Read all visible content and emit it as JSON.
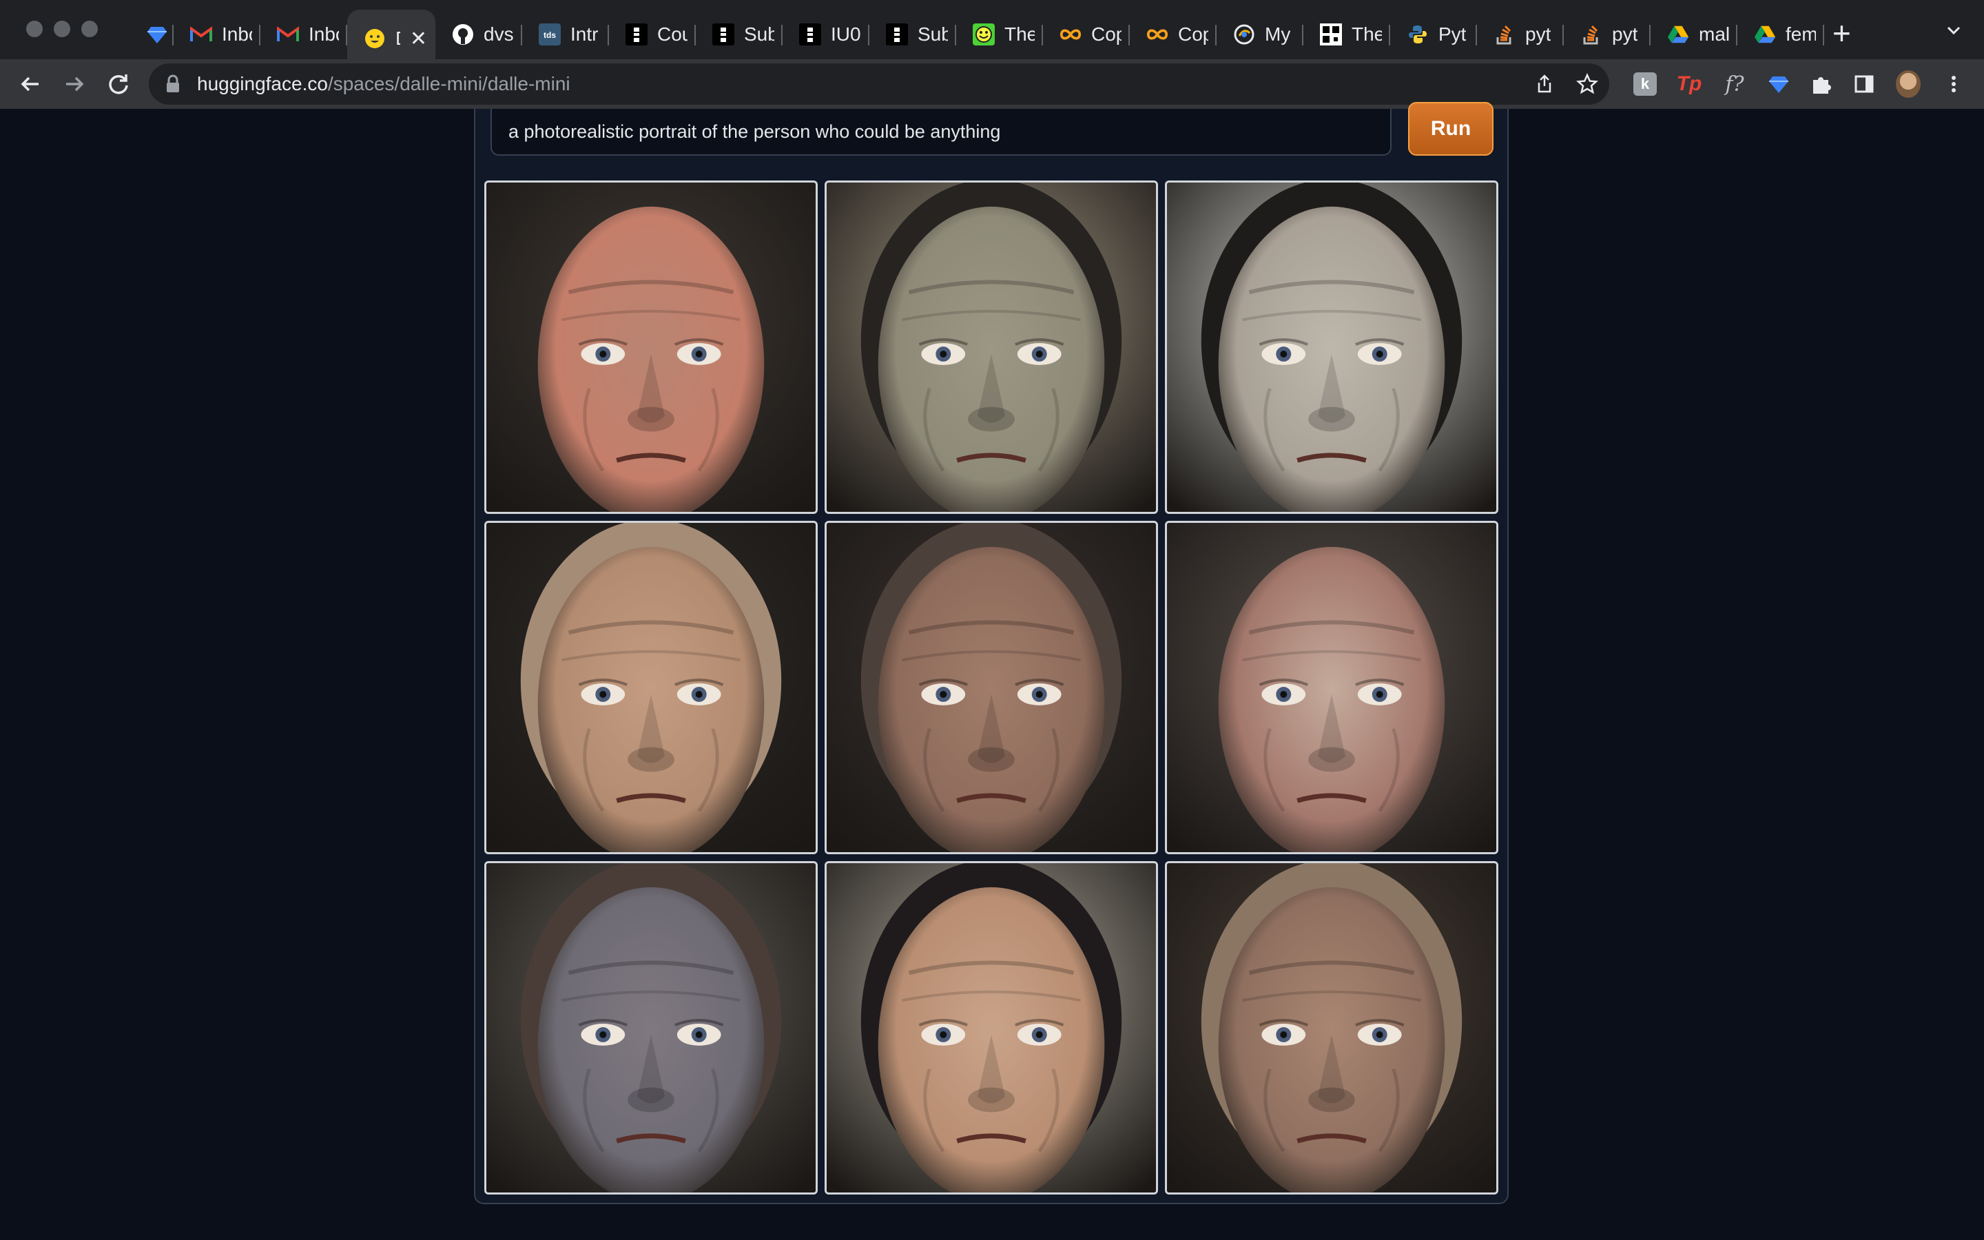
{
  "browser": {
    "tabs": [
      {
        "title": "",
        "icon": "gem-icon"
      },
      {
        "title": "Inbo",
        "icon": "gmail-icon"
      },
      {
        "title": "Inbo",
        "icon": "gmail-icon"
      },
      {
        "title": "D",
        "icon": "huggingface-icon",
        "active": true
      },
      {
        "title": "dvs",
        "icon": "github-icon"
      },
      {
        "title": "Intr",
        "icon": "tds-icon"
      },
      {
        "title": "Cou",
        "icon": "dots-icon"
      },
      {
        "title": "Sub",
        "icon": "dots-icon"
      },
      {
        "title": "IU0",
        "icon": "dots-icon"
      },
      {
        "title": "Sub",
        "icon": "dots-icon"
      },
      {
        "title": "The",
        "icon": "smiley-icon"
      },
      {
        "title": "Cop",
        "icon": "infinity-icon"
      },
      {
        "title": "Cop",
        "icon": "infinity-icon"
      },
      {
        "title": "My",
        "icon": "bird-icon"
      },
      {
        "title": "The",
        "icon": "qr-icon"
      },
      {
        "title": "Pyt",
        "icon": "python-icon"
      },
      {
        "title": "pyt",
        "icon": "stackoverflow-icon"
      },
      {
        "title": "pyt",
        "icon": "stackoverflow-icon"
      },
      {
        "title": "mal",
        "icon": "drive-icon"
      },
      {
        "title": "fem",
        "icon": "drive-icon"
      }
    ],
    "url_host": "huggingface.co",
    "url_path": "/spaces/dalle-mini/dalle-mini"
  },
  "app": {
    "prompt_value": "a photorealistic portrait of the person who could be anything",
    "run_label": "Run",
    "images": [
      {
        "bg": "#3e3833",
        "skin": "#b98572",
        "hair": "none",
        "cheek": "#c47e6a"
      },
      {
        "bg": "#a59b86",
        "skin": "#9c9784",
        "hair": "#262321",
        "cheek": "#8e8a78"
      },
      {
        "bg": "#d4d6d0",
        "skin": "#bdb7ac",
        "hair": "#1e1c1a",
        "cheek": "#a9a196"
      },
      {
        "bg": "#2d2a27",
        "skin": "#c49c82",
        "hair": "#a58c77",
        "cheek": "#b38b70"
      },
      {
        "bg": "#3b3431",
        "skin": "#a17c6a",
        "hair": "#4c403a",
        "cheek": "#8e6b5b"
      },
      {
        "bg": "#58504b",
        "skin": "#c4ab9c",
        "hair": "none",
        "cheek": "#a4786c"
      },
      {
        "bg": "#645f58",
        "skin": "#807880",
        "hair": "#4a3d38",
        "cheek": "#6e6b74"
      },
      {
        "bg": "#b7b1a3",
        "skin": "#c9a389",
        "hair": "#1f1b1d",
        "cheek": "#b98e72"
      },
      {
        "bg": "#4a3f37",
        "skin": "#a98672",
        "hair": "#8b7664",
        "cheek": "#8f6f5f"
      }
    ]
  }
}
